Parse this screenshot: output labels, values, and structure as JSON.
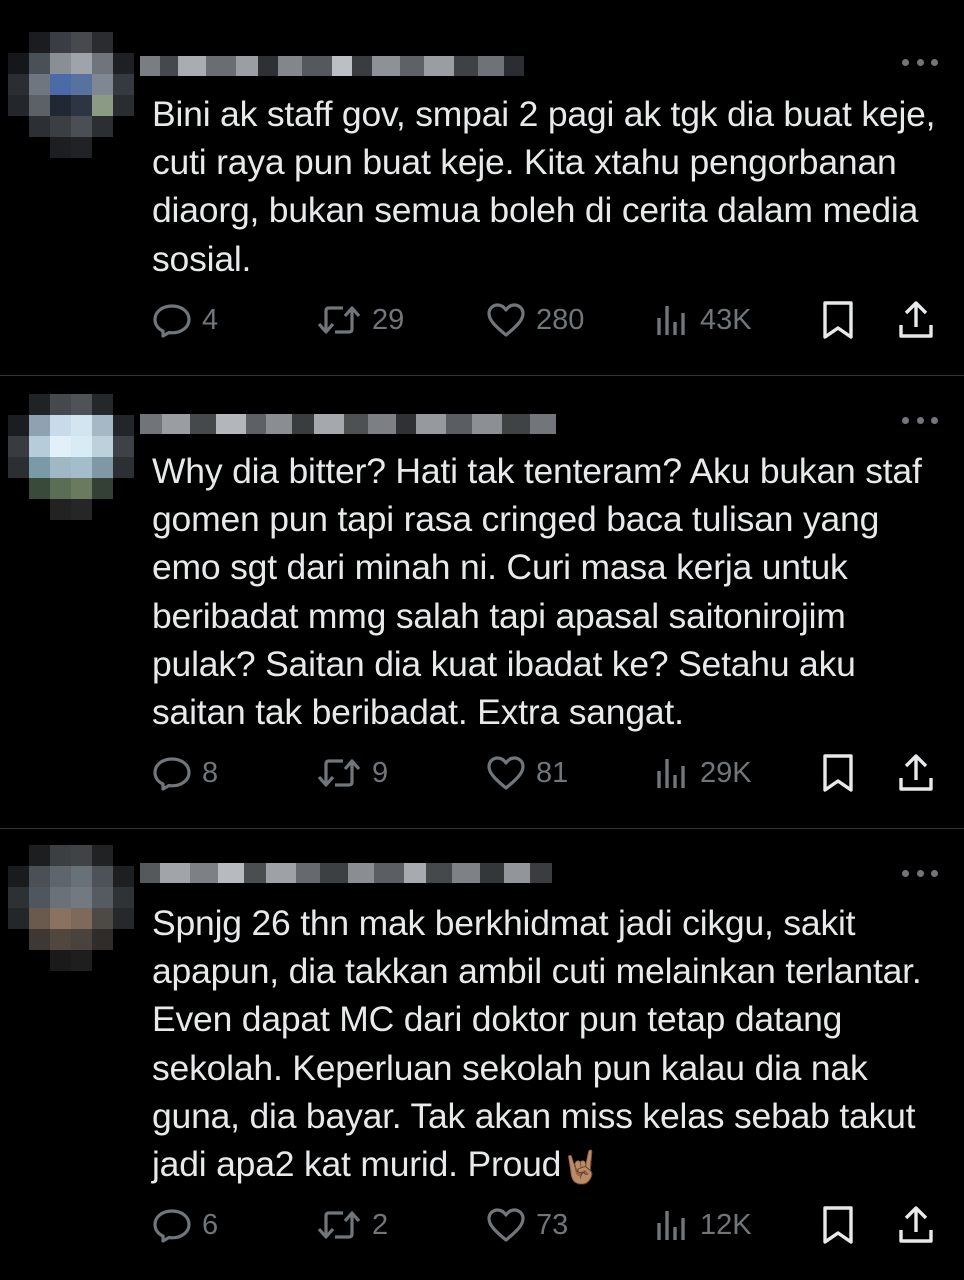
{
  "tweets": [
    {
      "text": "Bini ak staff gov, smpai 2 pagi ak tgk dia buat keje, cuti raya pun buat keje. Kita xtahu pengorbanan diaorg, bukan semua boleh di cerita dalam media sosial.",
      "replies": "4",
      "reposts": "29",
      "likes": "280",
      "views": "43K"
    },
    {
      "text": "Why dia bitter? Hati tak tenteram? Aku bukan staf gomen pun tapi rasa cringed baca tulisan yang emo sgt dari minah ni. Curi masa kerja untuk beribadat mmg salah tapi apasal saitonirojim pulak? Saitan dia kuat ibadat ke? Setahu aku saitan tak beribadat. Extra sangat.",
      "replies": "8",
      "reposts": "9",
      "likes": "81",
      "views": "29K"
    },
    {
      "text": "Spnjg 26 thn mak berkhidmat jadi cikgu, sakit apapun, dia takkan ambil cuti melainkan terlantar. Even dapat MC dari doktor pun tetap datang sekolah. Keperluan sekolah pun kalau dia nak guna, dia bayar. Tak akan miss kelas sebab takut jadi apa2 kat murid. Proud",
      "emoji": "🤘🏽",
      "replies": "6",
      "reposts": "2",
      "likes": "73",
      "views": "12K"
    }
  ],
  "icons": {
    "reply": "reply-icon",
    "repost": "repost-icon",
    "like": "heart-icon",
    "views": "views-icon",
    "bookmark": "bookmark-icon",
    "share": "share-icon",
    "more": "more-icon"
  },
  "colors": {
    "background": "#000000",
    "text": "#e7e9ea",
    "muted": "#71767b",
    "divider": "#2f3336"
  }
}
